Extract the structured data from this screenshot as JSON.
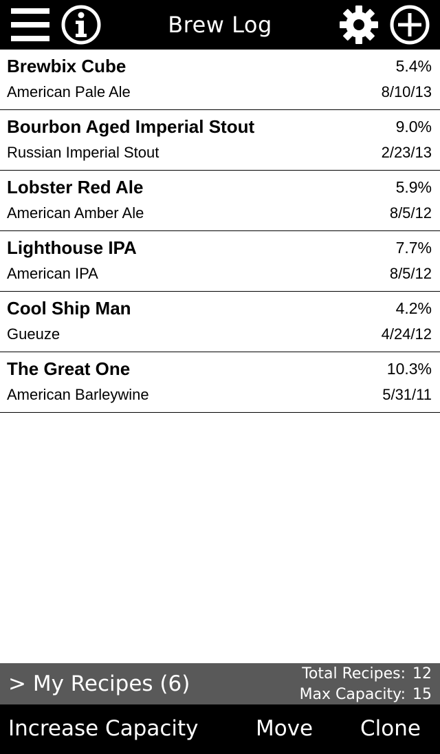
{
  "header": {
    "title": "Brew Log",
    "icons": {
      "menu": "menu-icon",
      "info": "info-icon",
      "settings": "gear-icon",
      "add": "add-icon"
    }
  },
  "recipes": [
    {
      "name": "Brewbix Cube",
      "abv": "5.4%",
      "style": "American Pale Ale",
      "date": "8/10/13"
    },
    {
      "name": "Bourbon Aged Imperial Stout",
      "abv": "9.0%",
      "style": "Russian Imperial Stout",
      "date": "2/23/13"
    },
    {
      "name": "Lobster Red Ale",
      "abv": "5.9%",
      "style": "American Amber Ale",
      "date": "8/5/12"
    },
    {
      "name": "Lighthouse IPA",
      "abv": "7.7%",
      "style": "American IPA",
      "date": "8/5/12"
    },
    {
      "name": "Cool Ship Man",
      "abv": "4.2%",
      "style": "Gueuze",
      "date": "4/24/12"
    },
    {
      "name": "The Great One",
      "abv": "10.3%",
      "style": "American Barleywine",
      "date": "5/31/11"
    }
  ],
  "folder_bar": {
    "folder_label": "> My Recipes (6)",
    "total_label": "Total Recipes:",
    "total_value": "12",
    "capacity_label": "Max Capacity:",
    "capacity_value": "15"
  },
  "toolbar": {
    "increase_label": "Increase Capacity",
    "move_label": "Move",
    "clone_label": "Clone"
  },
  "colors": {
    "bar_background": "#000000",
    "folder_bar_background": "#595959",
    "list_background": "#ffffff"
  }
}
